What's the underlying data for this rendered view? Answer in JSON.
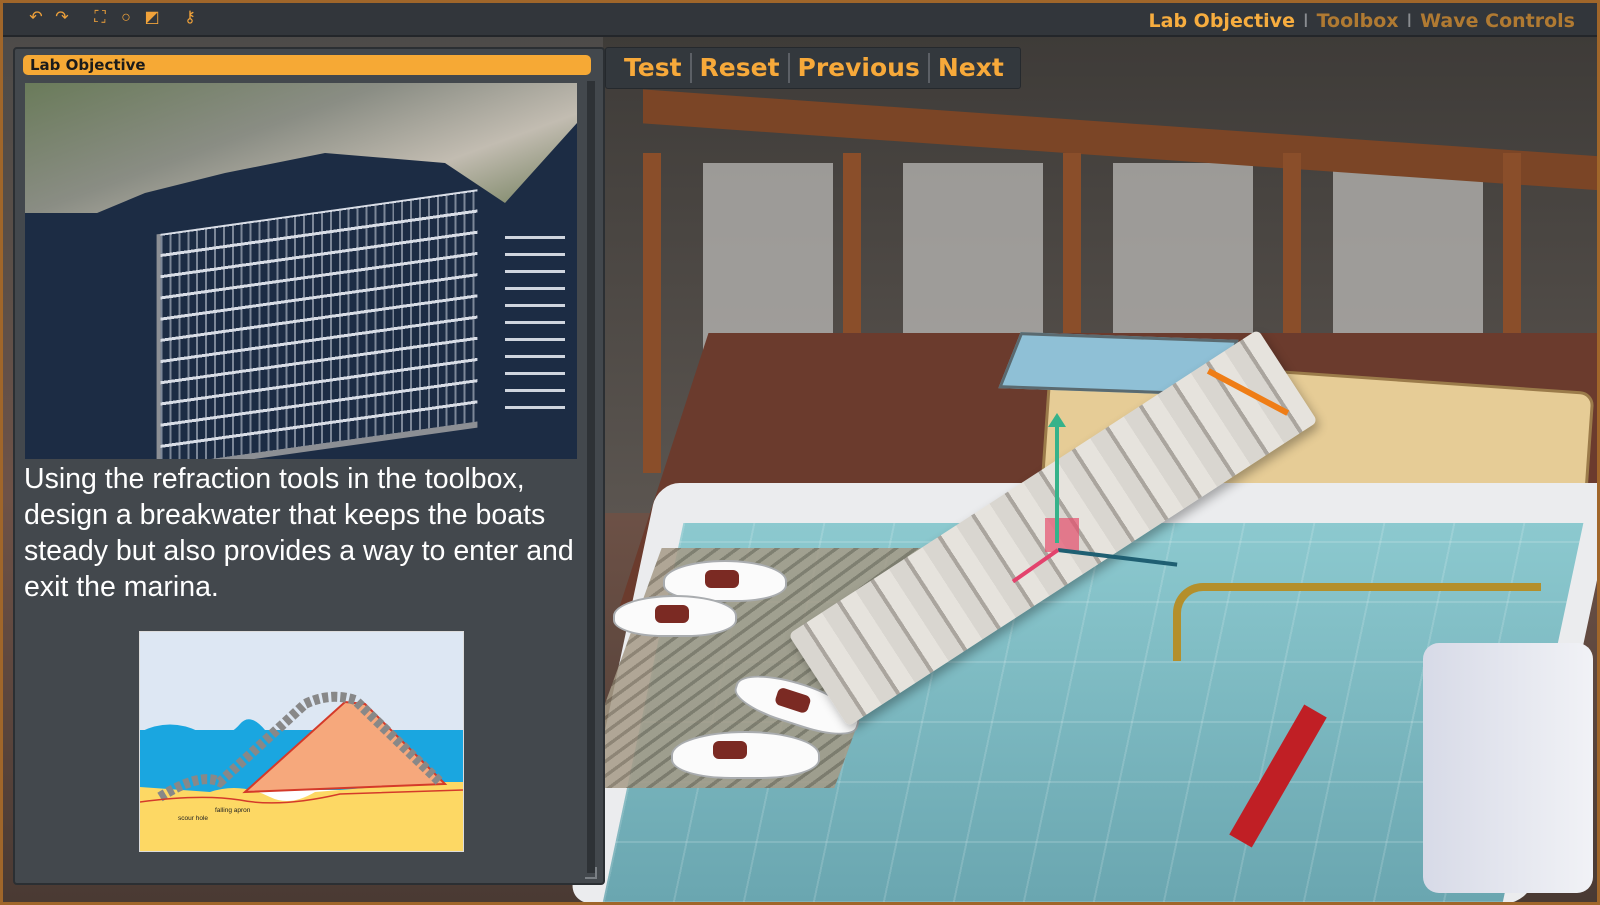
{
  "toolbar": {
    "icons": [
      "undo-icon",
      "redo-icon",
      "fullscreen-icon",
      "circle-icon",
      "resize-window-icon",
      "key-icon"
    ],
    "undo_glyph": "↶",
    "redo_glyph": "↷",
    "fullscreen_glyph": "⛶",
    "circle_glyph": "○",
    "window_glyph": "◩",
    "key_glyph": "⚷"
  },
  "nav": {
    "lab_objective": "Lab Objective",
    "toolbox": "Toolbox",
    "wave_controls": "Wave Controls",
    "separator": "I",
    "active": "Lab Objective"
  },
  "panel": {
    "title": "Lab Objective",
    "objective_text": "Using the refraction tools in the toolbox, design a breakwater that keeps the boats steady but also provides a way to enter and exit the marina.",
    "diagram": {
      "label_scour": "scour hole",
      "label_apron": "falling apron"
    }
  },
  "actions": {
    "test": "Test",
    "reset": "Reset",
    "previous": "Previous",
    "next": "Next"
  },
  "colors": {
    "accent": "#f7a93a",
    "frame": "#a0662a",
    "panel_bg": "#43484d",
    "toolbar_bg": "#32363b"
  }
}
